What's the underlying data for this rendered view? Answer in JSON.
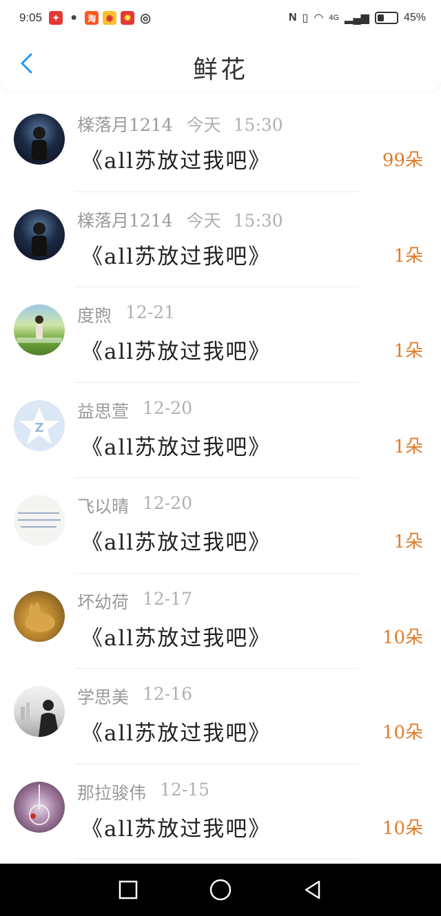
{
  "status_bar": {
    "time": "9:05",
    "network": "4G",
    "battery": "45%",
    "battery_level": 0.45,
    "icons": [
      "app-icon",
      "wechat-icon",
      "taobao-icon",
      "weibo-icon",
      "app-icon",
      "eye-icon",
      "nfc-icon",
      "vibrate-icon",
      "wifi-icon",
      "signal-icon",
      "battery-icon"
    ]
  },
  "header": {
    "title": "鲜花",
    "back_icon": "chevron-left-icon"
  },
  "colors": {
    "accent": "#2196F3",
    "count": "#E07C2A",
    "meta": "#9A9A9A"
  },
  "list": {
    "items": [
      {
        "name": "檪落月1214",
        "date": "今天",
        "time": "15:30",
        "book": "《all苏放过我吧》",
        "count": "99朵",
        "avatar": "avatar-dark-stage"
      },
      {
        "name": "檪落月1214",
        "date": "今天",
        "time": "15:30",
        "book": "《all苏放过我吧》",
        "count": "1朵",
        "avatar": "avatar-dark-stage"
      },
      {
        "name": "度煦",
        "date": "12-21",
        "time": "",
        "book": "《all苏放过我吧》",
        "count": "1朵",
        "avatar": "avatar-girl-grass"
      },
      {
        "name": "益思萱",
        "date": "12-20",
        "time": "",
        "book": "《all苏放过我吧》",
        "count": "1朵",
        "avatar": "avatar-qzone-star"
      },
      {
        "name": "飞以晴",
        "date": "12-20",
        "time": "",
        "book": "《all苏放过我吧》",
        "count": "1朵",
        "avatar": "avatar-handwriting"
      },
      {
        "name": "坏幼荷",
        "date": "12-17",
        "time": "",
        "book": "《all苏放过我吧》",
        "count": "10朵",
        "avatar": "avatar-rabbit"
      },
      {
        "name": "学思美",
        "date": "12-16",
        "time": "",
        "book": "《all苏放过我吧》",
        "count": "10朵",
        "avatar": "avatar-silhouette"
      },
      {
        "name": "那拉骏伟",
        "date": "12-15",
        "time": "",
        "book": "《all苏放过我吧》",
        "count": "10朵",
        "avatar": "avatar-glass"
      }
    ]
  },
  "nav_bar": {
    "icons": [
      "recent-apps-icon",
      "home-icon",
      "back-icon"
    ]
  }
}
